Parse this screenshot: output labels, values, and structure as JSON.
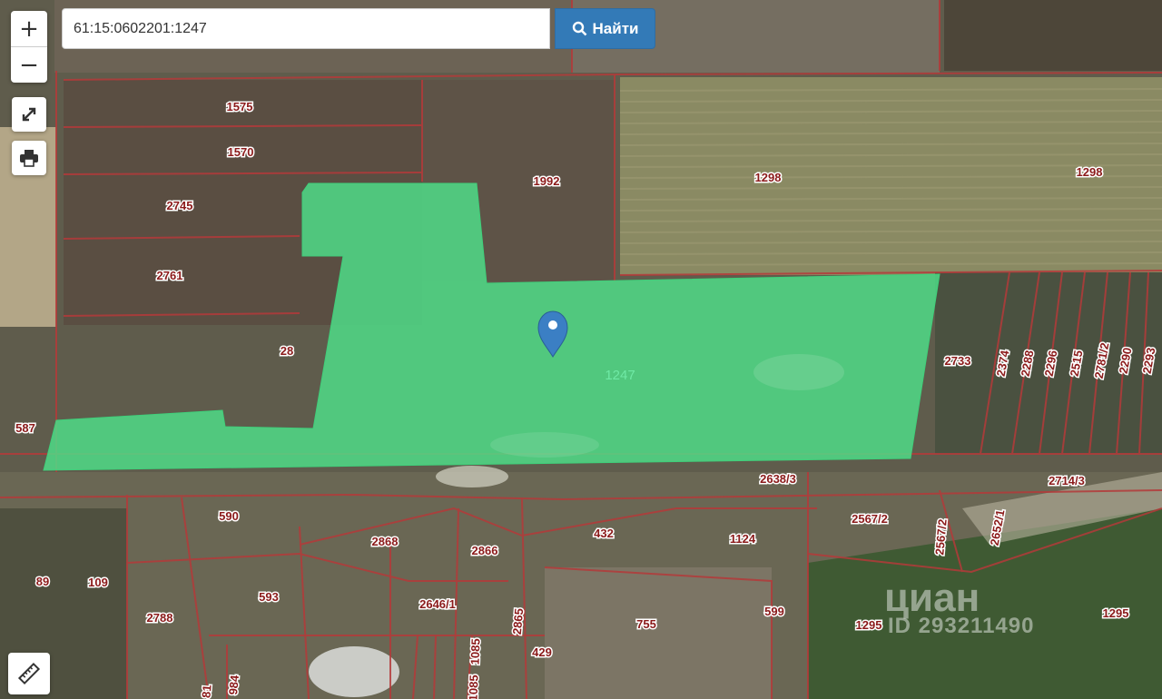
{
  "search": {
    "value": "61:15:0602201:1247",
    "button_label": "Найти"
  },
  "controls": {
    "zoom_in": "+",
    "zoom_out": "−"
  },
  "map": {
    "selected_parcel": "1247",
    "parcel_labels": [
      "1575",
      "1570",
      "2745",
      "2761",
      "28",
      "587",
      "1992",
      "1298",
      "1298",
      "2733",
      "2374",
      "2288",
      "2296",
      "2515",
      "2781/2",
      "2290",
      "2293",
      "2638/3",
      "2714/3",
      "2567/2",
      "2567/2",
      "2652/1",
      "590",
      "2868",
      "2866",
      "432",
      "1124",
      "89",
      "109",
      "593",
      "2788",
      "2646/1",
      "2865",
      "1085",
      "1085",
      "429",
      "755",
      "599",
      "1295",
      "1295",
      "984",
      "81"
    ]
  },
  "watermark": {
    "brand": "циан",
    "id_text": "ID 293211490"
  }
}
